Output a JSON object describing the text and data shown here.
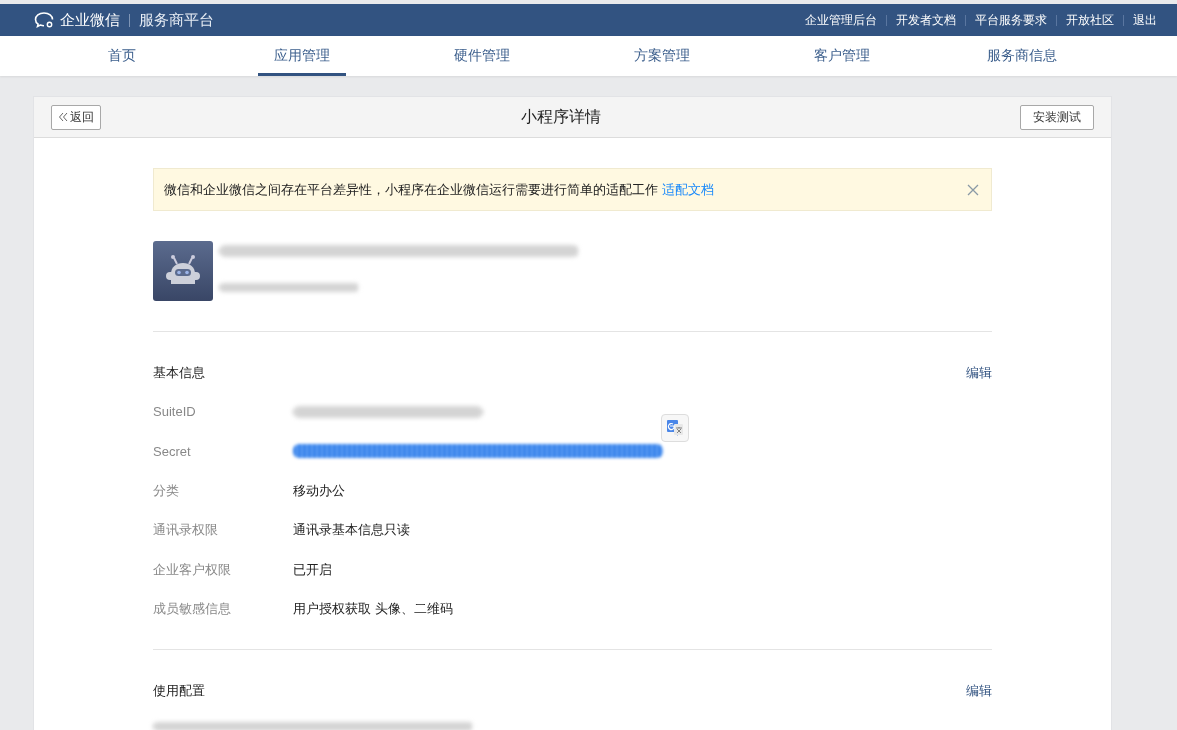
{
  "topbar": {
    "brand": "企业微信",
    "product": "服务商平台",
    "links": [
      "企业管理后台",
      "开发者文档",
      "平台服务要求",
      "开放社区",
      "退出"
    ]
  },
  "nav": [
    {
      "label": "首页",
      "selected": false
    },
    {
      "label": "应用管理",
      "selected": true
    },
    {
      "label": "硬件管理",
      "selected": false
    },
    {
      "label": "方案管理",
      "selected": false
    },
    {
      "label": "客户管理",
      "selected": false
    },
    {
      "label": "服务商信息",
      "selected": false
    }
  ],
  "header": {
    "back": "返回",
    "title": "小程序详情",
    "action": "安装测试"
  },
  "notice": {
    "text": "微信和企业微信之间存在平台差异性，小程序在企业微信运行需要进行简单的适配工作",
    "link": "适配文档"
  },
  "sections": [
    {
      "title": "基本信息",
      "edit": "编辑",
      "rows": [
        {
          "label": "SuiteID",
          "kind": "blurred",
          "highlighted": false
        },
        {
          "label": "Secret",
          "kind": "blurred",
          "highlighted": true
        },
        {
          "label": "分类",
          "kind": "text",
          "value": "移动办公"
        },
        {
          "label": "通讯录权限",
          "kind": "text",
          "value": "通讯录基本信息只读"
        },
        {
          "label": "企业客户权限",
          "kind": "text",
          "value": "已开启"
        },
        {
          "label": "成员敏感信息",
          "kind": "text",
          "value": "用户授权获取 头像、二维码"
        }
      ]
    },
    {
      "title": "使用配置",
      "edit": "编辑"
    }
  ]
}
